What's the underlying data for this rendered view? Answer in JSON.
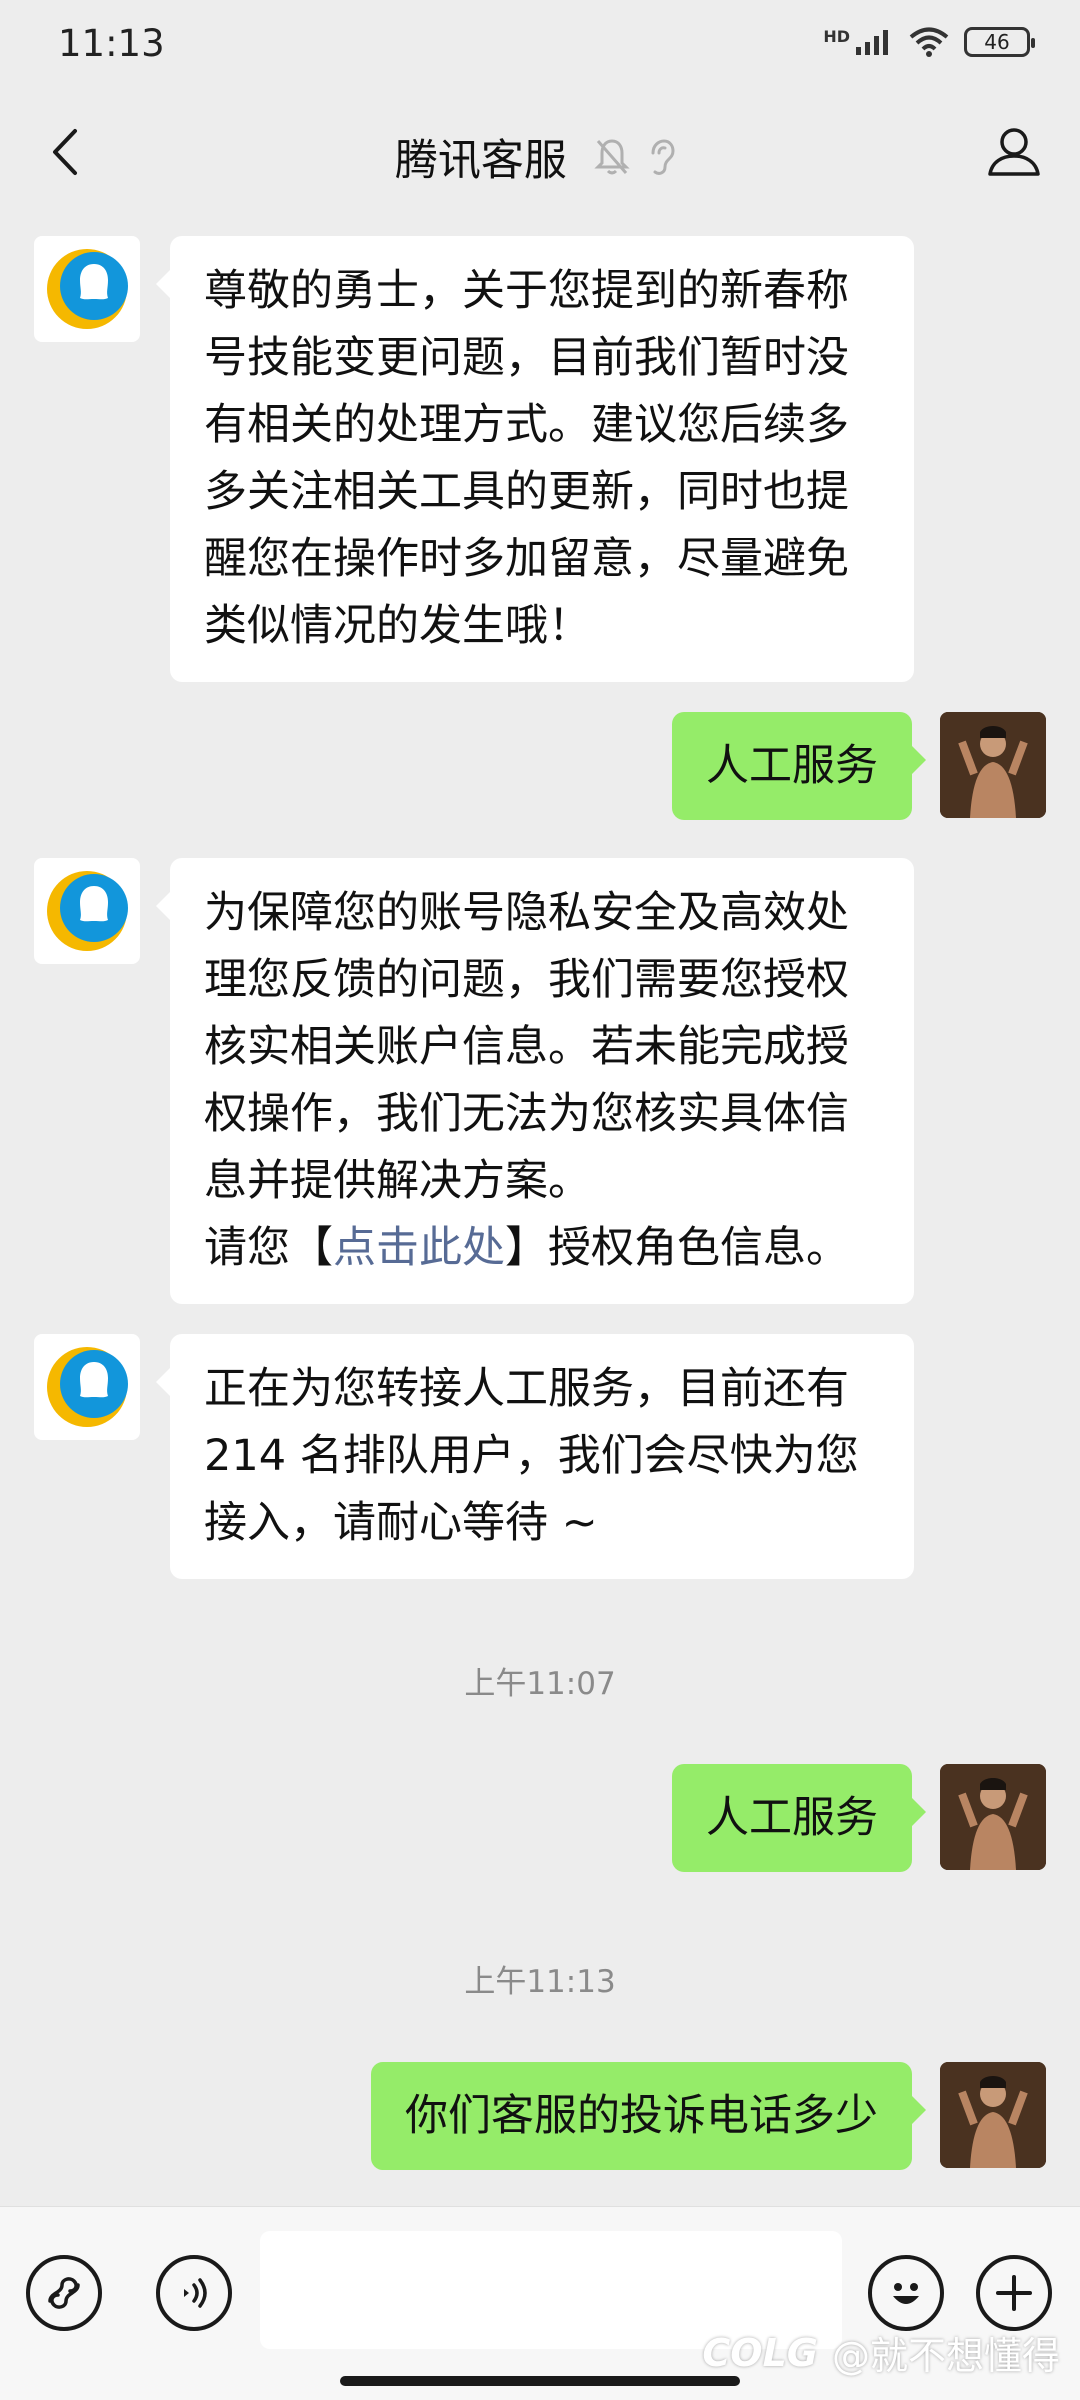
{
  "status_bar": {
    "time": "11:13",
    "network": "HD",
    "battery": "46"
  },
  "header": {
    "title": "腾讯客服"
  },
  "messages": [
    {
      "side": "left",
      "text": "尊敬的勇士，关于您提到的新春称号技能变更问题，目前我们暂时没有相关的处理方式。建议您后续多多关注相关工具的更新，同时也提醒您在操作时多加留意，尽量避免类似情况的发生哦！"
    },
    {
      "side": "right",
      "text": "人工服务"
    },
    {
      "side": "left",
      "text": "为保障您的账号隐私安全及高效处理您反馈的问题，我们需要您授权核实相关账户信息。若未能完成授权操作，我们无法为您核实具体信息并提供解决方案。",
      "line2_prefix": "请您【",
      "link": "点击此处",
      "line2_suffix": "】授权角色信息。"
    },
    {
      "side": "left",
      "text": "正在为您转接人工服务，目前还有214 名排队用户，我们会尽快为您接入，请耐心等待 ~"
    },
    {
      "side": "right",
      "text": "人工服务"
    },
    {
      "side": "right",
      "text": "你们客服的投诉电话多少"
    }
  ],
  "timestamps": [
    "上午11:07",
    "上午11:13"
  ],
  "input_bar": {
    "placeholder": ""
  },
  "watermark": {
    "brand": "COLG",
    "handle": "@就不想懂得"
  },
  "colors": {
    "background": "#ededed",
    "bubble_self": "#95ec69",
    "bubble_other": "#ffffff",
    "link": "#576b95"
  },
  "icons": [
    "back-icon",
    "mute-bell-icon",
    "ear-icon",
    "profile-icon",
    "mini-program-icon",
    "voice-icon",
    "emoji-icon",
    "plus-icon",
    "qq-penguin-icon"
  ]
}
